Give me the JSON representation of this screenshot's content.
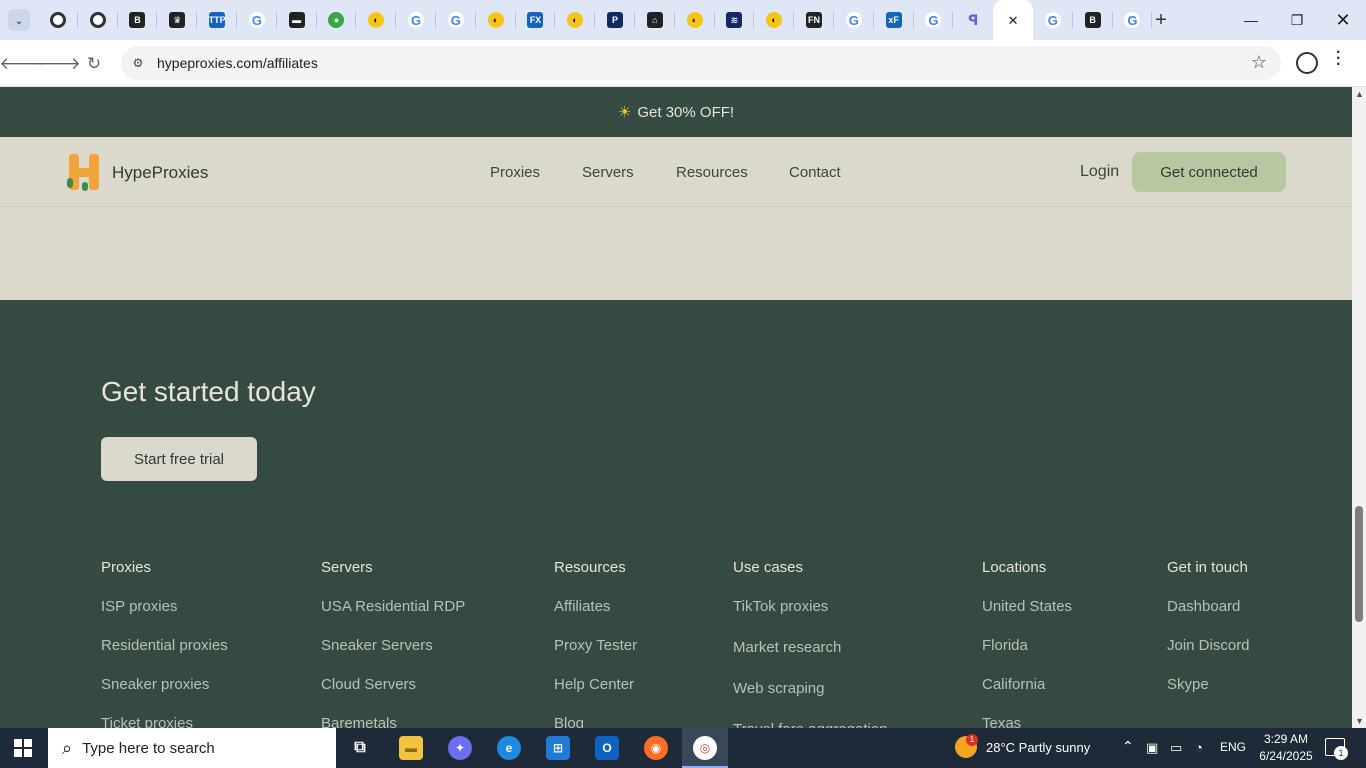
{
  "browser": {
    "url": "hypeproxies.com/affiliates",
    "tabs": [
      {
        "icon": "openai-icon"
      },
      {
        "icon": "openai-icon"
      },
      {
        "icon": "b-icon"
      },
      {
        "icon": "crown-icon"
      },
      {
        "icon": "ttp-icon"
      },
      {
        "icon": "google-icon"
      },
      {
        "icon": "bar-icon"
      },
      {
        "icon": "globe-icon"
      },
      {
        "icon": "logo-icon"
      },
      {
        "icon": "google-icon"
      },
      {
        "icon": "google-icon"
      },
      {
        "icon": "logo-icon"
      },
      {
        "icon": "fx-icon"
      },
      {
        "icon": "logo-icon"
      },
      {
        "icon": "p-icon"
      },
      {
        "icon": "house-icon"
      },
      {
        "icon": "logo-icon"
      },
      {
        "icon": "wave-icon"
      },
      {
        "icon": "logo-icon"
      },
      {
        "icon": "fn-icon"
      },
      {
        "icon": "google-icon"
      },
      {
        "icon": "xf-icon"
      },
      {
        "icon": "google-icon"
      },
      {
        "icon": "puzzle-icon"
      },
      {
        "icon": "close-icon",
        "active": true
      },
      {
        "icon": "google-icon"
      },
      {
        "icon": "b-icon"
      },
      {
        "icon": "google-icon"
      }
    ],
    "tab_glyphs": [
      "◎",
      "◎",
      "B",
      "♛",
      "TTP",
      "G",
      "▬",
      "●",
      "◐",
      "G",
      "G",
      "◐",
      "FX",
      "◐",
      "P",
      "⌂",
      "◐",
      "≋",
      "◐",
      "FN",
      "G",
      "xF",
      "G",
      "ꟼ",
      "✕",
      "G",
      "B",
      "G"
    ]
  },
  "site": {
    "promo": "Get 30% OFF!",
    "brand": "HypeProxies",
    "nav": [
      "Proxies",
      "Servers",
      "Resources",
      "Contact"
    ],
    "login": "Login",
    "cta": "Get connected",
    "headline": "Get started today",
    "trial_button": "Start free trial",
    "footer": [
      {
        "heading": "Proxies",
        "links": [
          "ISP proxies",
          "Residential proxies",
          "Sneaker proxies",
          "Ticket proxies"
        ]
      },
      {
        "heading": "Servers",
        "links": [
          "USA Residential RDP",
          "Sneaker Servers",
          "Cloud Servers",
          "Baremetals"
        ]
      },
      {
        "heading": "Resources",
        "links": [
          "Affiliates",
          "Proxy Tester",
          "Help Center",
          "Blog"
        ]
      },
      {
        "heading": "Use cases",
        "links": [
          "TikTok proxies",
          "Market research",
          "Web scraping",
          "Travel fare aggregation"
        ]
      },
      {
        "heading": "Locations",
        "links": [
          "United States",
          "Florida",
          "California",
          "Texas"
        ]
      },
      {
        "heading": "Get in touch",
        "links": [
          "Dashboard",
          "Join Discord",
          "Skype"
        ]
      }
    ]
  },
  "taskbar": {
    "search_placeholder": "Type here to search",
    "weather": "28°C  Partly sunny",
    "weather_badge": "1",
    "language": "ENG",
    "time": "3:29 AM",
    "date": "6/24/2025",
    "notification_count": "1"
  },
  "colors": {
    "page_dark": "#354a41",
    "page_beige": "#dbd8cc",
    "cta_green": "#b7c8a0"
  }
}
